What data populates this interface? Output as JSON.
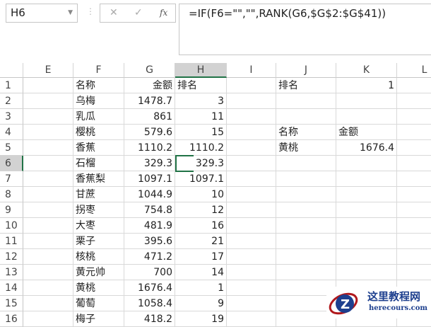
{
  "name_box": "H6",
  "formula": "=IF(F6=\"\",\"\",RANK(G6,$G$2:$G$41))",
  "columns": [
    "E",
    "F",
    "G",
    "H",
    "I",
    "J",
    "K",
    "L"
  ],
  "rows": [
    [
      "名称",
      "金额",
      "排名",
      "排名",
      "1"
    ],
    [
      "乌梅",
      "1478.7",
      "3",
      "",
      ""
    ],
    [
      "乳瓜",
      "861",
      "11",
      "",
      ""
    ],
    [
      "樱桃",
      "579.6",
      "15",
      "名称",
      "金额"
    ],
    [
      "香蕉",
      "1110.2",
      "1110.2",
      "黄桃",
      "1676.4"
    ],
    [
      "石榴",
      "329.3",
      "329.3",
      "",
      ""
    ],
    [
      "香蕉梨",
      "1097.1",
      "1097.1",
      "",
      ""
    ],
    [
      "甘蔗",
      "1044.9",
      "10",
      "",
      ""
    ],
    [
      "拐枣",
      "754.8",
      "12",
      "",
      ""
    ],
    [
      "大枣",
      "481.9",
      "16",
      "",
      ""
    ],
    [
      "栗子",
      "395.6",
      "21",
      "",
      ""
    ],
    [
      "核桃",
      "471.2",
      "17",
      "",
      ""
    ],
    [
      "黄元帅",
      "700",
      "14",
      "",
      ""
    ],
    [
      "黄桃",
      "1676.4",
      "1",
      "",
      ""
    ],
    [
      "葡萄",
      "1058.4",
      "9",
      "",
      ""
    ],
    [
      "梅子",
      "418.2",
      "19",
      "",
      ""
    ]
  ],
  "watermark": {
    "title": "这里教程网",
    "url": "herecours.com"
  }
}
